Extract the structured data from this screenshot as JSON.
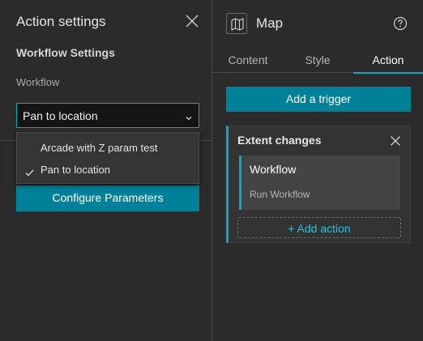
{
  "left_panel": {
    "title": "Action settings",
    "section_label": "Workflow Settings",
    "field_label": "Workflow",
    "select_value": "Pan to location",
    "dropdown_options": [
      {
        "label": "Arcade with Z param test",
        "selected": false
      },
      {
        "label": "Pan to location",
        "selected": true
      }
    ],
    "configure_button": "Configure Parameters"
  },
  "right_panel": {
    "title": "Map",
    "tabs": [
      {
        "label": "Content",
        "active": false
      },
      {
        "label": "Style",
        "active": false
      },
      {
        "label": "Action",
        "active": true
      }
    ],
    "add_trigger_button": "Add a trigger",
    "trigger": {
      "title": "Extent changes",
      "action": {
        "title": "Workflow",
        "subtitle": "Run Workflow"
      },
      "add_action_label": "+ Add action"
    }
  },
  "icons": {
    "close": "close-icon",
    "chevron": "chevron-down-icon",
    "check": "check-icon",
    "map": "map-icon",
    "help": "help-icon"
  },
  "colors": {
    "accent": "#0aa9c2",
    "button": "#00819a",
    "background": "#2b2b2b"
  }
}
